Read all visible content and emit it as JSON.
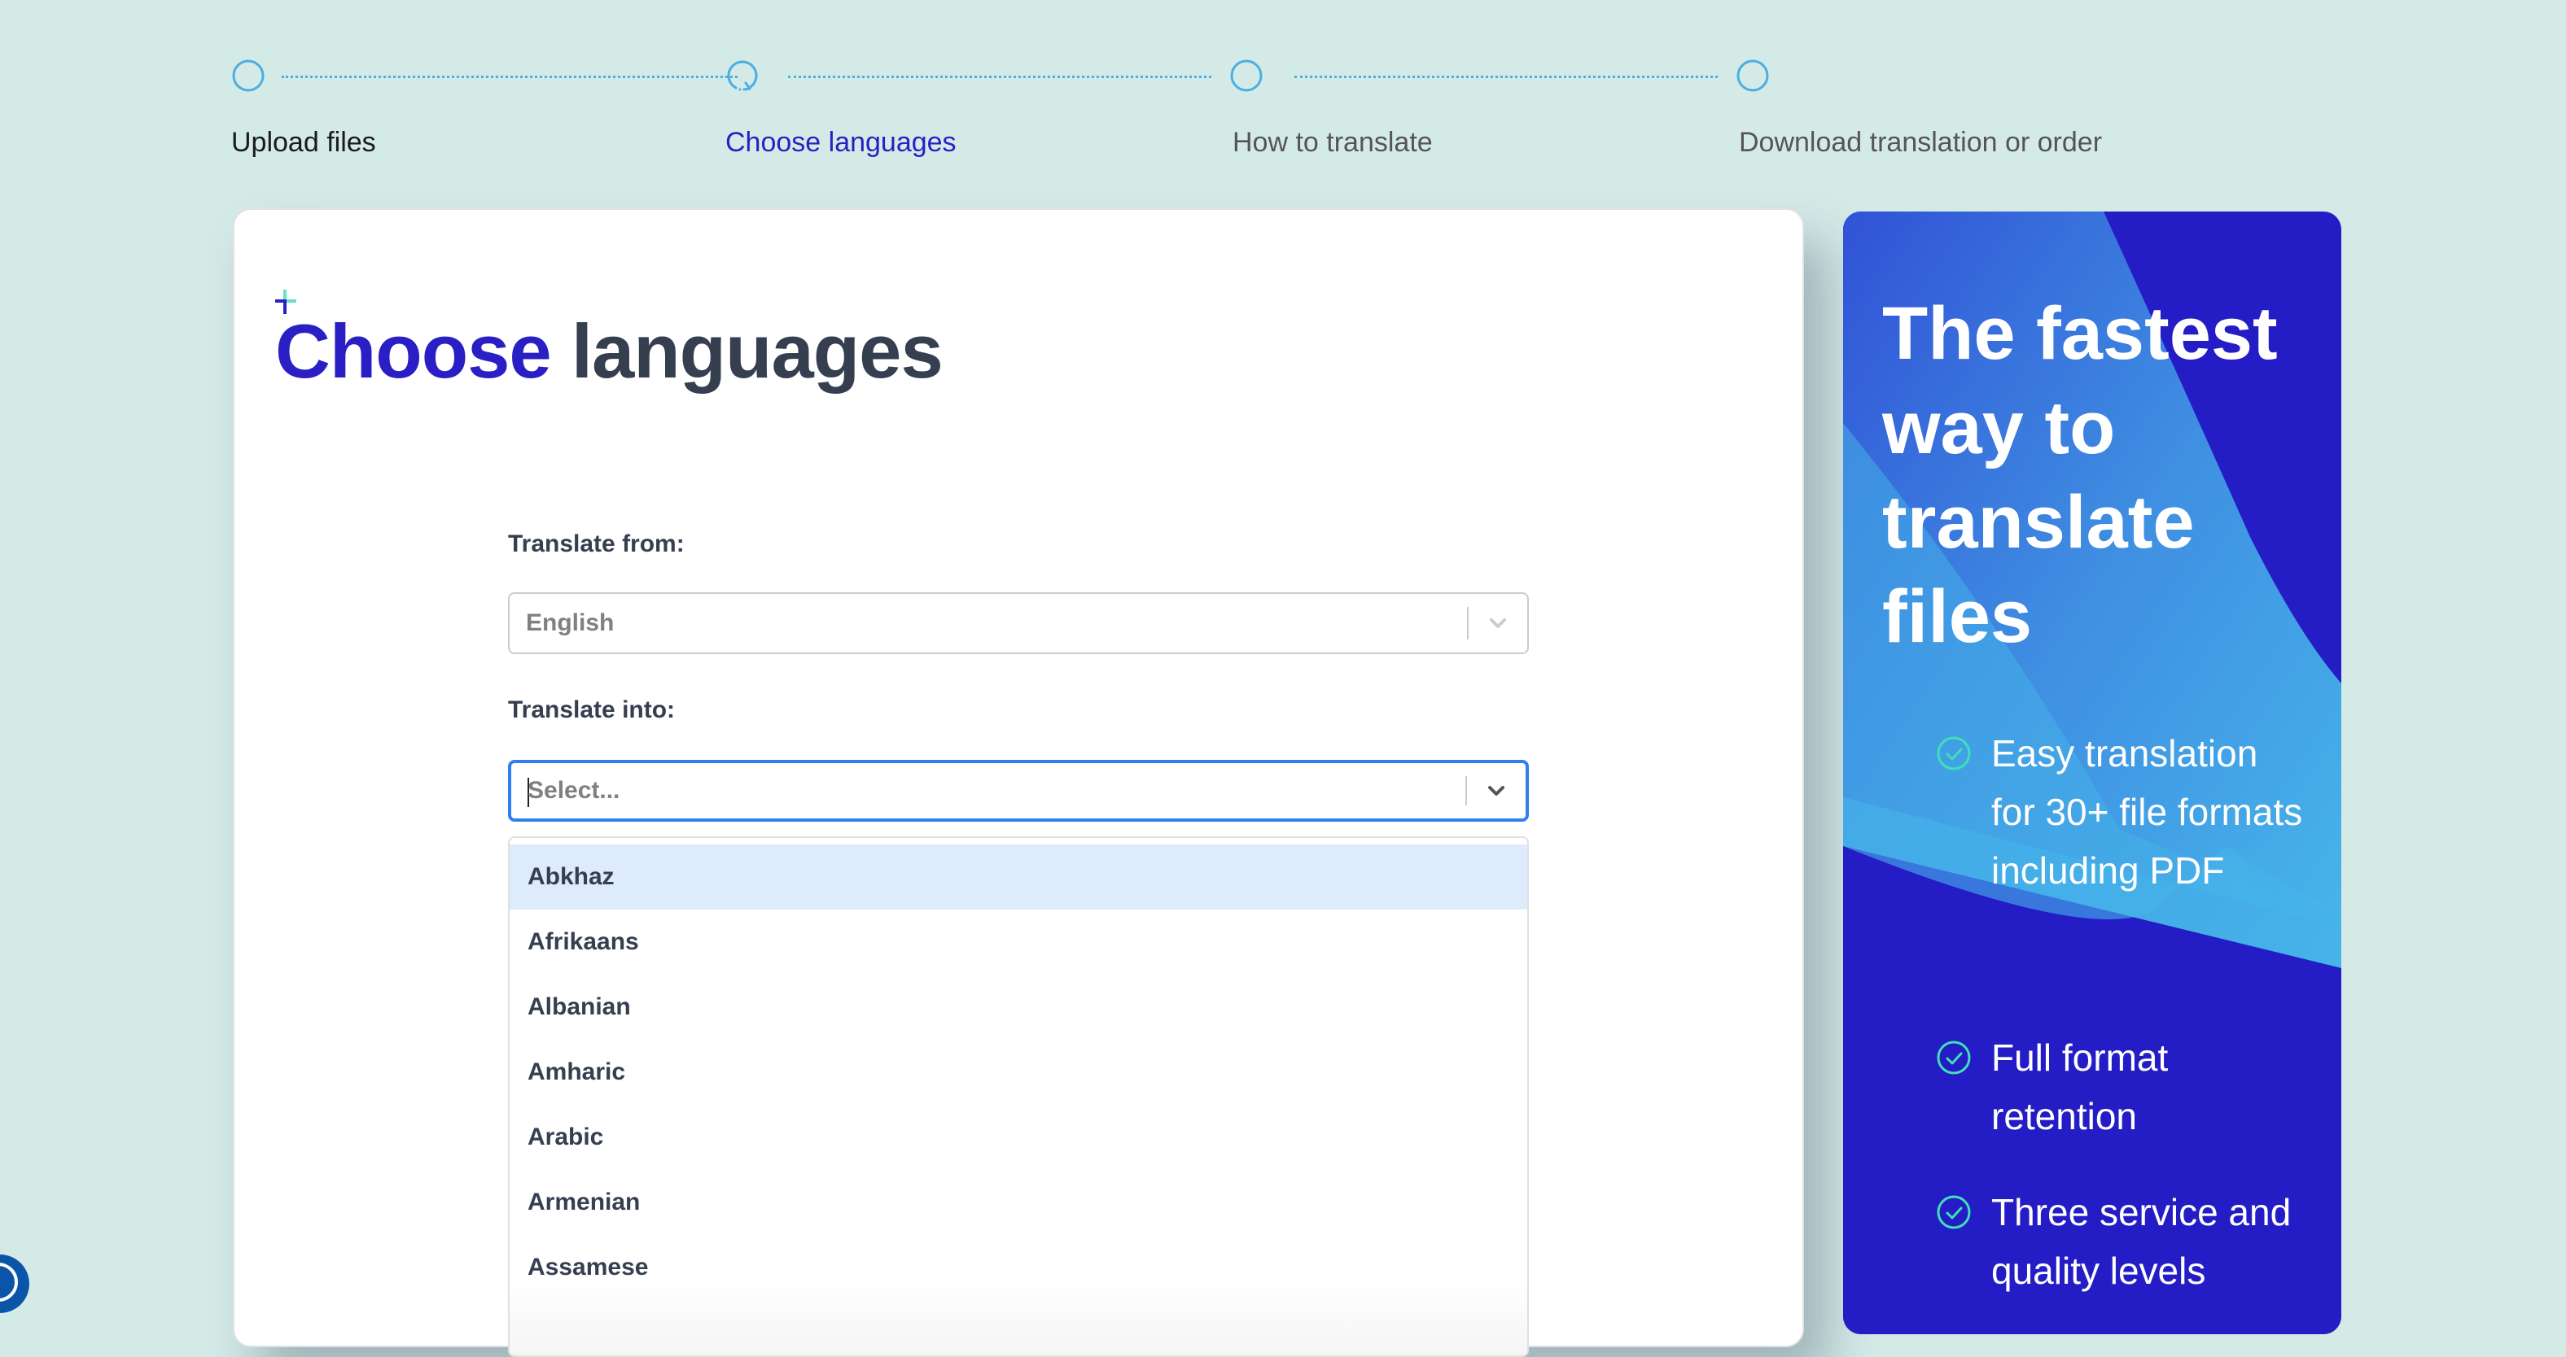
{
  "stepper": {
    "steps": [
      {
        "label": "Upload files",
        "state": "done"
      },
      {
        "label": "Choose languages",
        "state": "active"
      },
      {
        "label": "How to translate",
        "state": "pending"
      },
      {
        "label": "Download translation or order",
        "state": "pending"
      }
    ]
  },
  "page": {
    "title_accent": "Choose",
    "title_rest": "languages"
  },
  "form": {
    "from_label": "Translate from:",
    "from_value": "English",
    "into_label": "Translate into:",
    "into_placeholder": "Select...",
    "options": [
      "Abkhaz",
      "Afrikaans",
      "Albanian",
      "Amharic",
      "Arabic",
      "Armenian",
      "Assamese"
    ],
    "highlighted_option": "Abkhaz"
  },
  "promo": {
    "title": "The fastest way to translate files",
    "benefits": [
      "Easy translation for 30+ file formats including PDF",
      "Full format retention",
      "Three service and quality levels"
    ]
  },
  "colors": {
    "accent": "#2a1fc4",
    "step_line": "#4aafe3",
    "focus": "#2f80ed",
    "check": "#3fe0b8",
    "highlight": "#deebfc"
  }
}
